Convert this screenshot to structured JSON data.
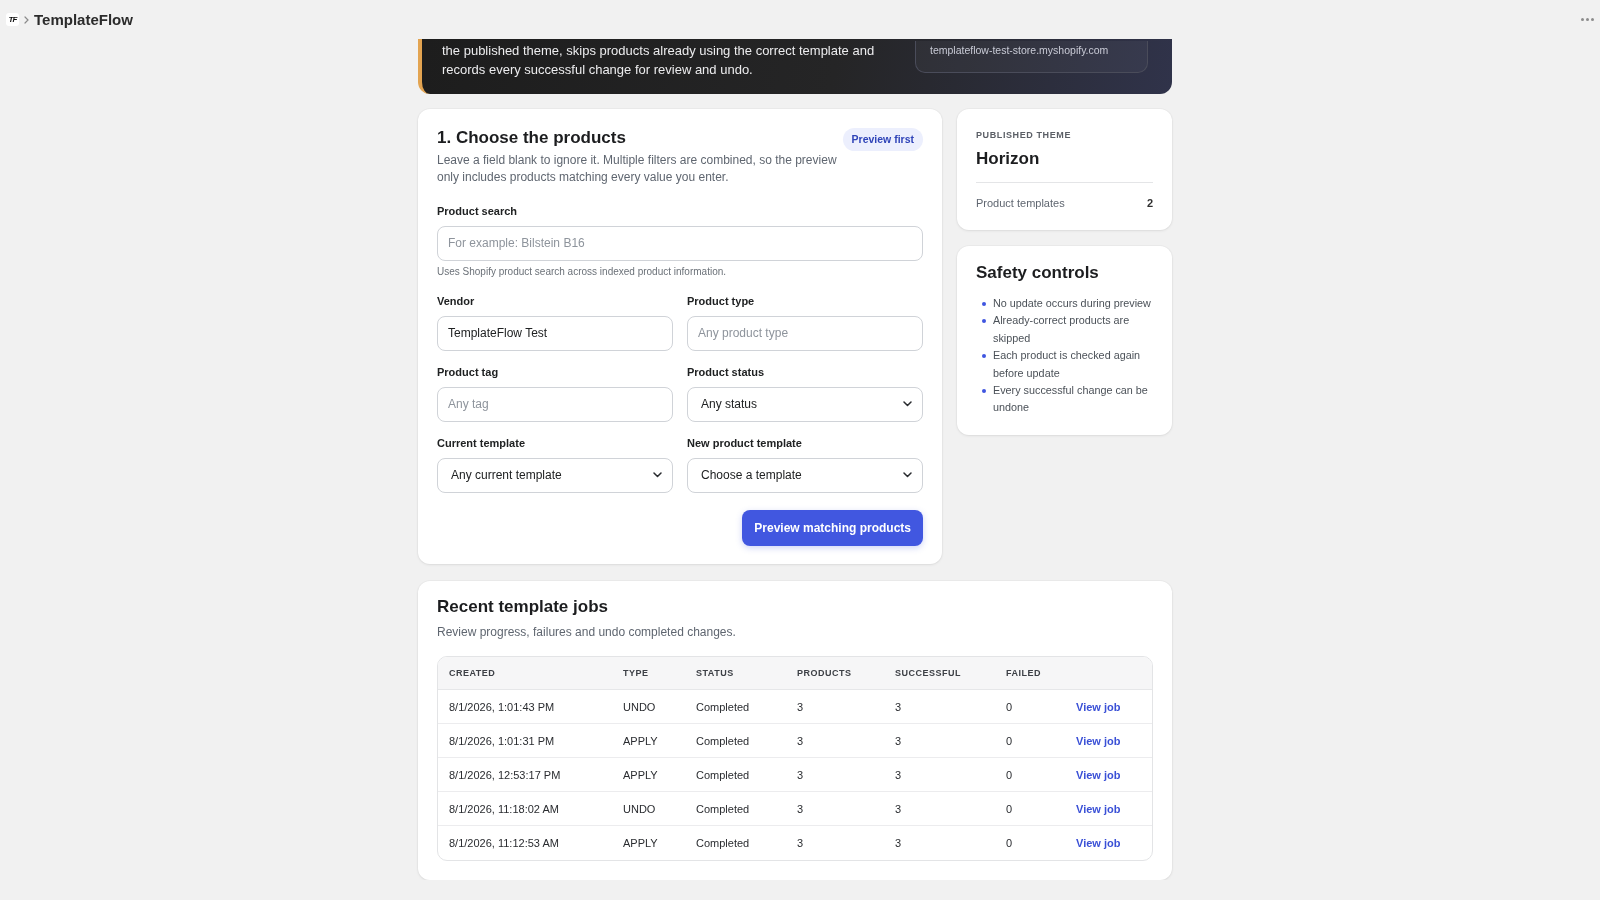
{
  "top_bar": {
    "logo": "TF",
    "title": "TemplateFlow"
  },
  "hero": {
    "description": "the published theme, skips products already using the correct template and records every successful change for review and undo.",
    "store_domain": "templateflow-test-store.myshopify.com"
  },
  "filters": {
    "title": "1. Choose the products",
    "badge": "Preview first",
    "description": "Leave a field blank to ignore it. Multiple filters are combined, so the preview only includes products matching every value you enter.",
    "search": {
      "label": "Product search",
      "placeholder": "For example: Bilstein B16",
      "hint": "Uses Shopify product search across indexed product information."
    },
    "fields": [
      {
        "kind": "input",
        "label": "Vendor",
        "value": "TemplateFlow Test"
      },
      {
        "kind": "input",
        "label": "Product type",
        "placeholder": "Any product type"
      },
      {
        "kind": "input",
        "label": "Product tag",
        "placeholder": "Any tag"
      },
      {
        "kind": "select",
        "label": "Product status",
        "value": "Any status"
      },
      {
        "kind": "select",
        "label": "Current template",
        "value": "Any current template"
      },
      {
        "kind": "select",
        "label": "New product template",
        "value": "Choose a template"
      }
    ],
    "submit": "Preview matching products"
  },
  "theme": {
    "eyebrow": "PUBLISHED THEME",
    "name": "Horizon",
    "stat_label": "Product templates",
    "stat_value": "2"
  },
  "safety": {
    "title": "Safety controls",
    "items": [
      "No update occurs during preview",
      "Already-correct products are skipped",
      "Each product is checked again before update",
      "Every successful change can be undone"
    ]
  },
  "jobs": {
    "title": "Recent template jobs",
    "description": "Review progress, failures and undo completed changes.",
    "table": {
      "columns": [
        "CREATED",
        "TYPE",
        "STATUS",
        "PRODUCTS",
        "SUCCESSFUL",
        "FAILED"
      ],
      "rows": [
        {
          "created": "8/1/2026, 1:01:43 PM",
          "type": "UNDO",
          "status": "Completed",
          "products": "3",
          "successful": "3",
          "failed": "0",
          "action": "View job"
        },
        {
          "created": "8/1/2026, 1:01:31 PM",
          "type": "APPLY",
          "status": "Completed",
          "products": "3",
          "successful": "3",
          "failed": "0",
          "action": "View job"
        },
        {
          "created": "8/1/2026, 12:53:17 PM",
          "type": "APPLY",
          "status": "Completed",
          "products": "3",
          "successful": "3",
          "failed": "0",
          "action": "View job"
        },
        {
          "created": "8/1/2026, 11:18:02 AM",
          "type": "UNDO",
          "status": "Completed",
          "products": "3",
          "successful": "3",
          "failed": "0",
          "action": "View job"
        },
        {
          "created": "8/1/2026, 11:12:53 AM",
          "type": "APPLY",
          "status": "Completed",
          "products": "3",
          "successful": "3",
          "failed": "0",
          "action": "View job"
        }
      ]
    }
  }
}
